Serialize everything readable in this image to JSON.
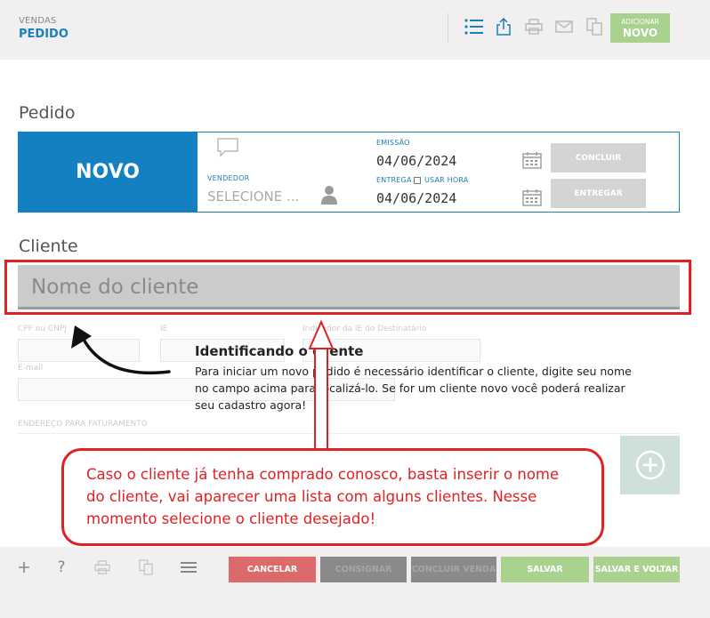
{
  "header": {
    "section": "VENDAS",
    "page": "PEDIDO",
    "icons": [
      "list-icon",
      "share-icon",
      "print-icon",
      "mail-icon",
      "copy-icon"
    ],
    "add_new": {
      "line1": "ADICIONAR",
      "line2": "NOVO",
      "color": "#a8d28e"
    }
  },
  "pedido": {
    "section_title": "Pedido",
    "status": "NOVO",
    "status_color": "#1381c1",
    "seller_label": "VENDEDOR",
    "seller_value": "SELECIONE ...",
    "emissao_label": "EMISSÃO",
    "emissao_date": "04/06/2024",
    "entrega_label": "ENTREGA",
    "usar_hora_label": "USAR HORA",
    "entrega_date": "04/06/2024",
    "concluir_button": "CONCLUIR",
    "entregar_button": "ENTREGAR"
  },
  "cliente": {
    "section_title": "Cliente",
    "name_placeholder": "Nome do cliente",
    "cpf_label": "CPF ou CNPJ",
    "ie_label": "IE",
    "indicador_label": "Indicador da IE do Destinatário",
    "email_label": "E-mail",
    "endereco_label": "ENDEREÇO PARA FATURAMENTO"
  },
  "tooltip": {
    "title": "Identificando o cliente",
    "body": "Para iniciar um novo pedido é necessário identificar o cliente, digite seu nome no campo acima para localizá-lo. Se for um cliente novo você poderá realizar seu cadastro agora!"
  },
  "annotation": {
    "text": "Caso o cliente já tenha comprado conosco, basta inserir o nome do cliente, vai aparecer uma lista com alguns clientes. Nesse momento selecione o cliente desejado!",
    "color": "#e02023"
  },
  "bottom": {
    "icons": [
      "plus-icon",
      "help-icon",
      "print-icon",
      "copy-icon",
      "menu-icon"
    ],
    "cancelar": "CANCELAR",
    "consignar": "CONSIGNAR",
    "concluir_venda": "CONCLUIR VENDA",
    "salvar": "SALVAR",
    "salvar_voltar": "SALVAR E VOLTAR",
    "colors": {
      "cancelar": "#dc6a6a",
      "disabled": "#8a8a8a",
      "save": "#a8d28e"
    }
  }
}
